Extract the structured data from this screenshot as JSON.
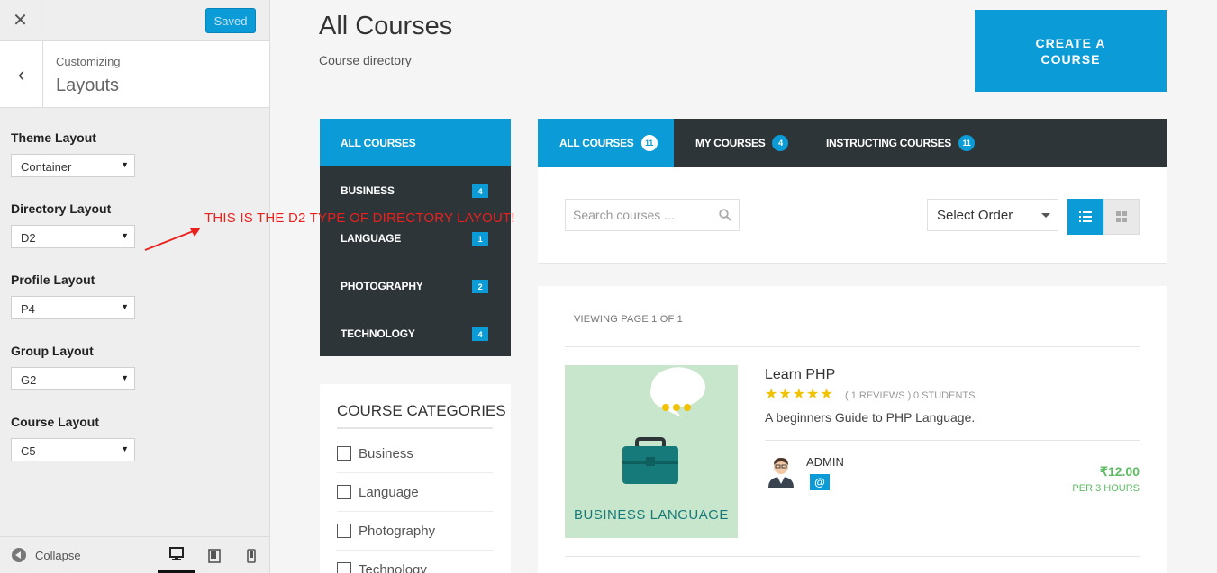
{
  "customizer": {
    "saved_label": "Saved",
    "breadcrumb": "Customizing",
    "section_title": "Layouts",
    "fields": [
      {
        "label": "Theme Layout",
        "value": "Container"
      },
      {
        "label": "Directory Layout",
        "value": "D2"
      },
      {
        "label": "Profile Layout",
        "value": "P4"
      },
      {
        "label": "Group Layout",
        "value": "G2"
      },
      {
        "label": "Course Layout",
        "value": "C5"
      }
    ],
    "collapse_label": "Collapse"
  },
  "annotation": "THIS IS THE D2 TYPE OF DIRECTORY LAYOUT!",
  "page": {
    "title": "All Courses",
    "subtitle": "Course directory",
    "create_button": "CREATE A COURSE"
  },
  "directory_nav": [
    {
      "label": "ALL COURSES",
      "count": ""
    },
    {
      "label": "BUSINESS",
      "count": "4"
    },
    {
      "label": "LANGUAGE",
      "count": "1"
    },
    {
      "label": "PHOTOGRAPHY",
      "count": "2"
    },
    {
      "label": "TECHNOLOGY",
      "count": "4"
    }
  ],
  "categories": {
    "title": "COURSE CATEGORIES",
    "items": [
      "Business",
      "Language",
      "Photography",
      "Technology"
    ]
  },
  "tabs": [
    {
      "label": "ALL COURSES",
      "count": "11"
    },
    {
      "label": "MY COURSES",
      "count": "4"
    },
    {
      "label": "INSTRUCTING COURSES",
      "count": "11"
    }
  ],
  "filters": {
    "search_placeholder": "Search courses ...",
    "order_label": "Select Order"
  },
  "listing": {
    "viewing": "VIEWING PAGE 1 OF 1",
    "course": {
      "thumbnail_text": "BUSINESS LANGUAGE",
      "title": "Learn PHP",
      "rating": 5,
      "reviews": "( 1 REVIEWS )",
      "students": "0 STUDENTS",
      "description": "A beginners Guide to PHP Language.",
      "author": "ADMIN",
      "author_badge": "@",
      "price": "₹12.00",
      "price_unit": "PER 3 HOURS"
    }
  },
  "colors": {
    "accent": "#0b9bd6",
    "dark_nav": "#2e3538",
    "price_green": "#5dbb63",
    "annotation_red": "#e8211f"
  }
}
